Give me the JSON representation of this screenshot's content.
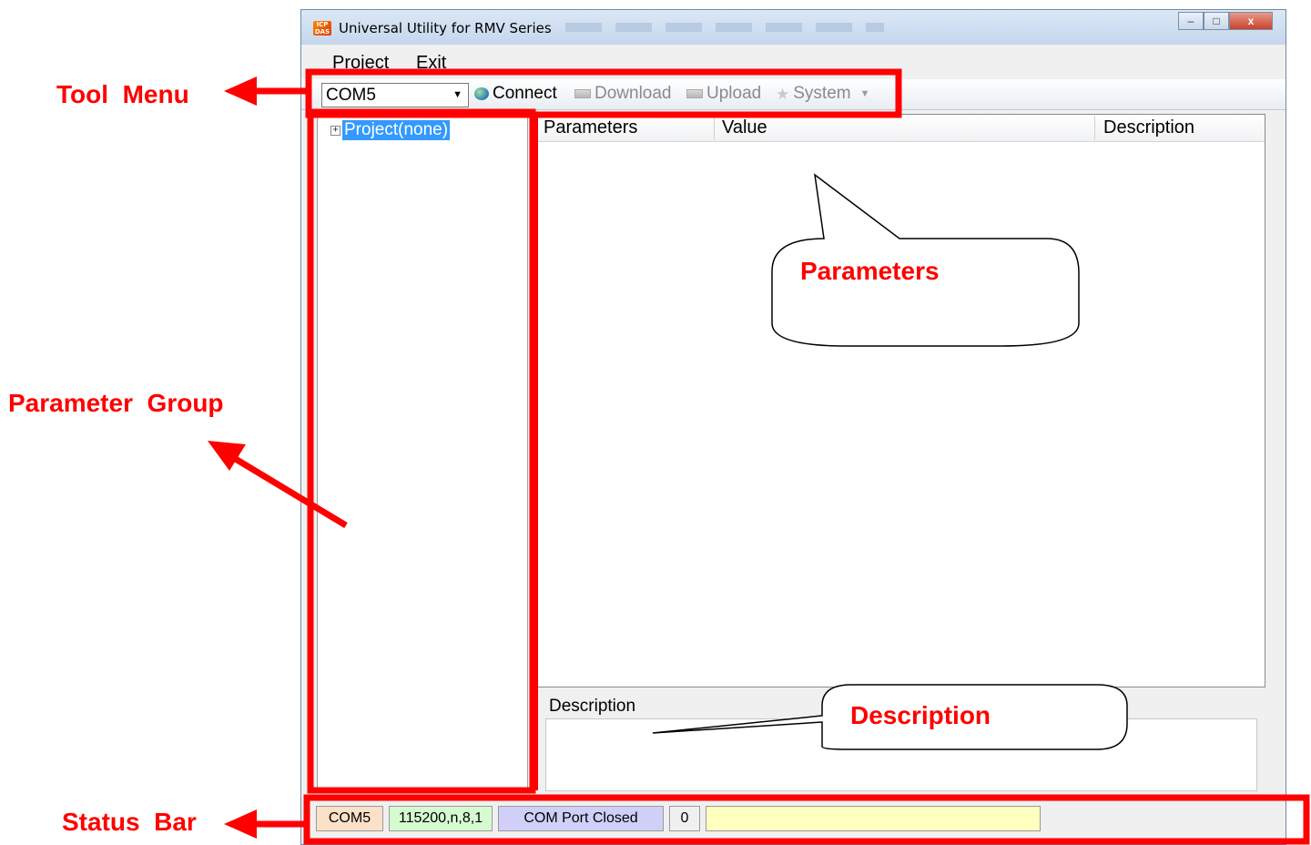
{
  "window": {
    "title": "Universal Utility for RMV Series",
    "icon": "icp-das-logo-icon",
    "controls": {
      "minimize": "–",
      "maximize": "□",
      "close": "x"
    }
  },
  "menu": {
    "items": [
      "Project",
      "Exit"
    ]
  },
  "toolbar": {
    "port_value": "COM5",
    "connect": "Connect",
    "download": "Download",
    "upload": "Upload",
    "system": "System"
  },
  "tree": {
    "root": "Project(none)"
  },
  "grid": {
    "columns": [
      "Parameters",
      "Value",
      "Description"
    ]
  },
  "description_panel": {
    "title": "Description"
  },
  "statusbar": {
    "port": "COM5",
    "settings": "115200,n,8,1",
    "state": "COM Port Closed",
    "count": "0",
    "message": ""
  },
  "annotations": {
    "tool_menu": "Tool  Menu",
    "parameter_group": "Parameter  Group",
    "status_bar": "Status  Bar",
    "parameters": "Parameters",
    "description": "Description",
    "color": "#ff0000"
  },
  "colors": {
    "status_port_bg": "#fce0c8",
    "status_settings_bg": "#d6fbd0",
    "status_state_bg": "#cfcff8",
    "status_message_bg": "#ffffc0",
    "selection": "#3399ff"
  }
}
